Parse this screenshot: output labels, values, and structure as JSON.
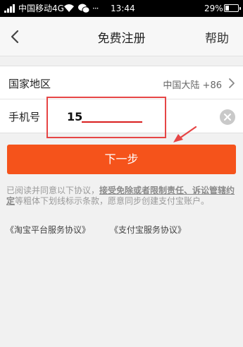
{
  "status_bar": {
    "carrier": "中国移动4G",
    "time": "13:44",
    "battery_pct": "29%",
    "battery_level": 0.29,
    "icons": [
      "signal-icon",
      "wifi-icon",
      "wechat-icon",
      "more-icon"
    ]
  },
  "header": {
    "title": "免费注册",
    "help_label": "帮助",
    "back_icon": "chevron-left-icon"
  },
  "form": {
    "region": {
      "label": "国家地区",
      "value": "中国大陆 +86"
    },
    "phone": {
      "label": "手机号",
      "value": "15"
    }
  },
  "next_button": {
    "label": "下一步"
  },
  "agreement": {
    "prefix": "已阅读并同意以下协议，",
    "bold": "接受免除或者限制责任、诉讼管辖约定",
    "suffix": "等粗体下划线标示条款，愿意同步创建支付宝账户。",
    "links": [
      "《淘宝平台服务协议》",
      "《支付宝服务协议》"
    ]
  },
  "colors": {
    "accent": "#f5531b",
    "annotation_red": "#e64545",
    "background": "#f1f1f1"
  }
}
